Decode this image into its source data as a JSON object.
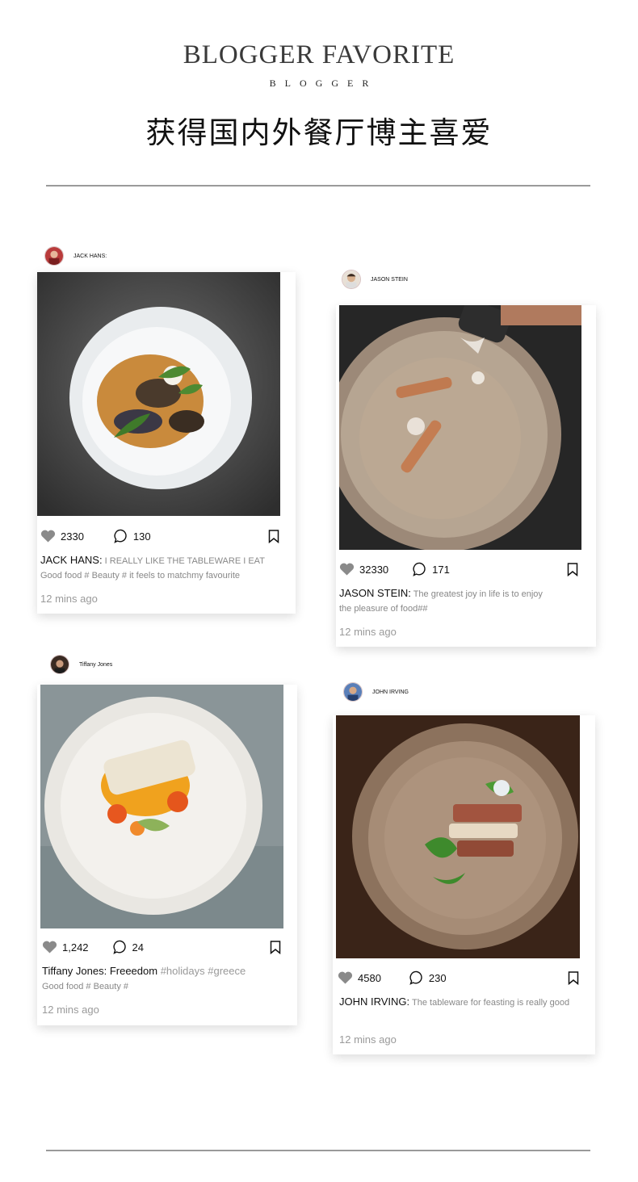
{
  "header": {
    "title": "BLOGGER FAVORITE",
    "subtitle": "BLOGGER",
    "cn_title": "获得国内外餐厅博主喜爱"
  },
  "posts": [
    {
      "author": "JACK HANS:",
      "likes": "2330",
      "comments": "130",
      "caption_name": "JACK HANS:",
      "caption_text": " I REALLY LIKE THE TABLEWARE I EAT",
      "caption_line2": "Good food # Beauty #   it feels to matchmy favourite",
      "time": "12 mins ago"
    },
    {
      "author": "JASON STEIN",
      "likes": "32330",
      "comments": "171",
      "caption_name": "JASON STEIN:",
      "caption_text": " The greatest joy in life is to enjoy",
      "caption_line2": "the pleasure of food##",
      "time": "12 mins ago"
    },
    {
      "author": "Tiffany Jones",
      "likes": "1,242",
      "comments": "24",
      "caption_name": "Tiffany Jones:",
      "caption_text": " Freeedom",
      "caption_tags": " #holidays #greece",
      "caption_line2": "Good food # Beauty #",
      "time": "12 mins ago"
    },
    {
      "author": "JOHN IRVING",
      "likes": "4580",
      "comments": "230",
      "caption_name": "JOHN IRVING:",
      "caption_text": " The tableware for feasting is really good",
      "time": "12 mins ago"
    }
  ],
  "colors": {
    "divider": "#9a9a9a",
    "icon": "#8a8a8a",
    "muted_text": "#9a9a9a"
  }
}
